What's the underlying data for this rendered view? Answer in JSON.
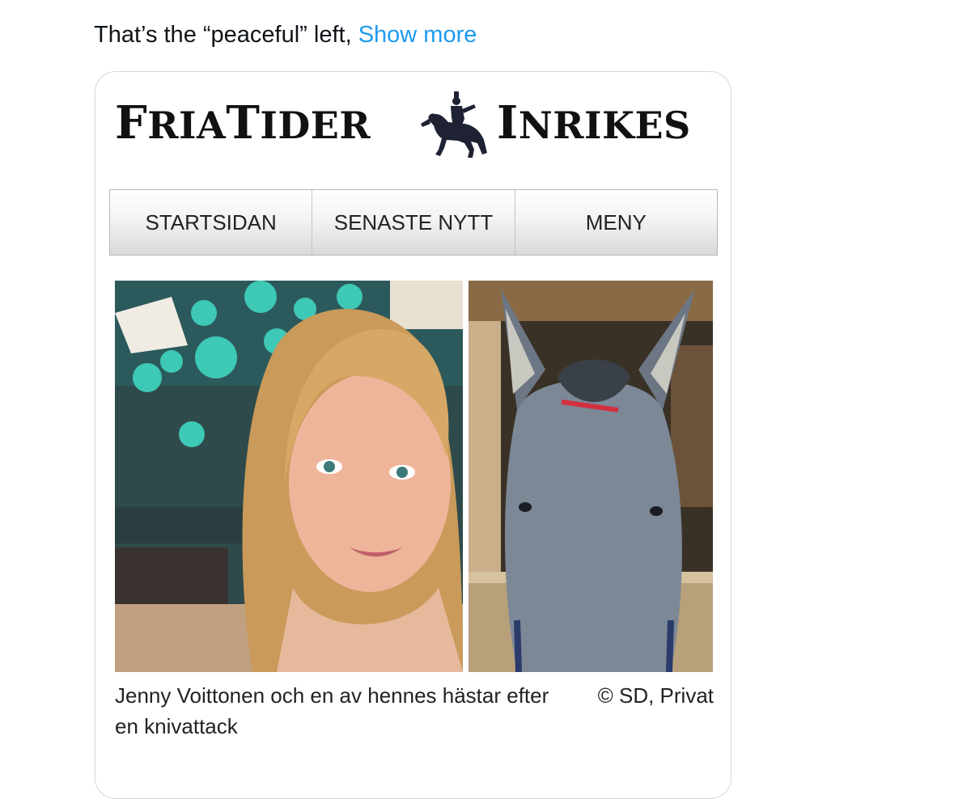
{
  "tweet": {
    "text": "That’s the “peaceful” left, ",
    "show_more": "Show more"
  },
  "card": {
    "masthead_left": {
      "cap1": "F",
      "rest1": "RIA",
      "cap2": "T",
      "rest2": "IDER"
    },
    "masthead_right": {
      "cap1": "I",
      "rest1": "NRIKES"
    },
    "logo_icon": "horse-rider-icon",
    "nav": [
      "STARTSIDAN",
      "SENASTE NYTT",
      "MENY"
    ],
    "caption": "Jenny Voittonen och en av hennes hästar efter en knivattack",
    "credit": "© SD, Privat"
  },
  "colors": {
    "link": "#1d9bf0",
    "text": "#0f1419",
    "card_border": "#cfd9de"
  }
}
